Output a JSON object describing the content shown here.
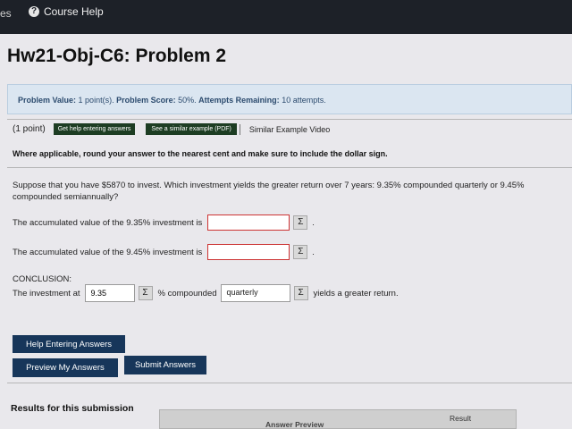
{
  "topbar": {
    "left_fragment": "es",
    "help_label": "Course Help"
  },
  "page": {
    "title": "Hw21-Obj-C6: Problem 2"
  },
  "problem_info": {
    "value_label": "Problem Value:",
    "value": "1 point(s).",
    "score_label": "Problem Score:",
    "score": "50%.",
    "attempts_label": "Attempts Remaining:",
    "attempts": "10 attempts."
  },
  "header_row": {
    "points": "(1 point)",
    "help_button": "Get help entering answers",
    "example_button": "See a similar example (PDF)",
    "video_link": "Similar Example Video"
  },
  "instruction": "Where applicable, round your answer to the nearest cent and make sure to include the dollar sign.",
  "problem_text": "Suppose that you have $5870 to invest. Which investment yields the greater return over 7 years: 9.35% compounded quarterly or 9.45% compounded semiannually?",
  "question1": {
    "label": "The accumulated value of the 9.35% investment is",
    "value": ""
  },
  "question2": {
    "label": "The accumulated value of the 9.45% investment is",
    "value": ""
  },
  "conclusion": {
    "title": "CONCLUSION:",
    "prefix": "The investment at",
    "rate_value": "9.35",
    "middle": "% compounded",
    "frequency_selected": "quarterly",
    "suffix": "yields a greater return."
  },
  "sigma_symbol": "Σ",
  "period": ".",
  "buttons": {
    "help_entering": "Help Entering Answers",
    "preview": "Preview My Answers",
    "submit": "Submit Answers"
  },
  "results": {
    "title": "Results for this submission",
    "col_answer_preview": "Answer Preview",
    "col_result": "Result"
  },
  "colors": {
    "topbar": "#1d2128",
    "info_box": "#dbe6f1",
    "button_green": "#1d3d23",
    "button_blue": "#17365a",
    "input_error_border": "#cc3333"
  },
  "icons": {
    "help": "question-circle-icon",
    "sigma": "sigma-icon"
  }
}
